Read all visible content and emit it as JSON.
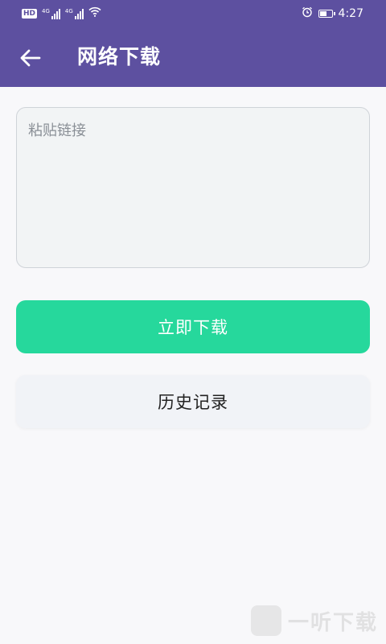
{
  "status_bar": {
    "hd_label": "HD",
    "network_1": "4G",
    "network_2": "4G",
    "time": "4:27",
    "battery_level": 0.6,
    "icons": [
      "hd-icon",
      "signal-icon",
      "signal-icon",
      "wifi-icon",
      "alarm-icon",
      "battery-icon"
    ]
  },
  "toolbar": {
    "back_icon": "arrow-left-icon",
    "title": "网络下载"
  },
  "link_input": {
    "placeholder": "粘贴链接",
    "value": ""
  },
  "buttons": {
    "download_label": "立即下载",
    "history_label": "历史记录"
  },
  "watermark": {
    "text": "一听下载"
  },
  "colors": {
    "header": "#5d50a0",
    "download_button": "#26d89c",
    "history_button": "#f1f3f7",
    "background": "#f8f8fa"
  }
}
